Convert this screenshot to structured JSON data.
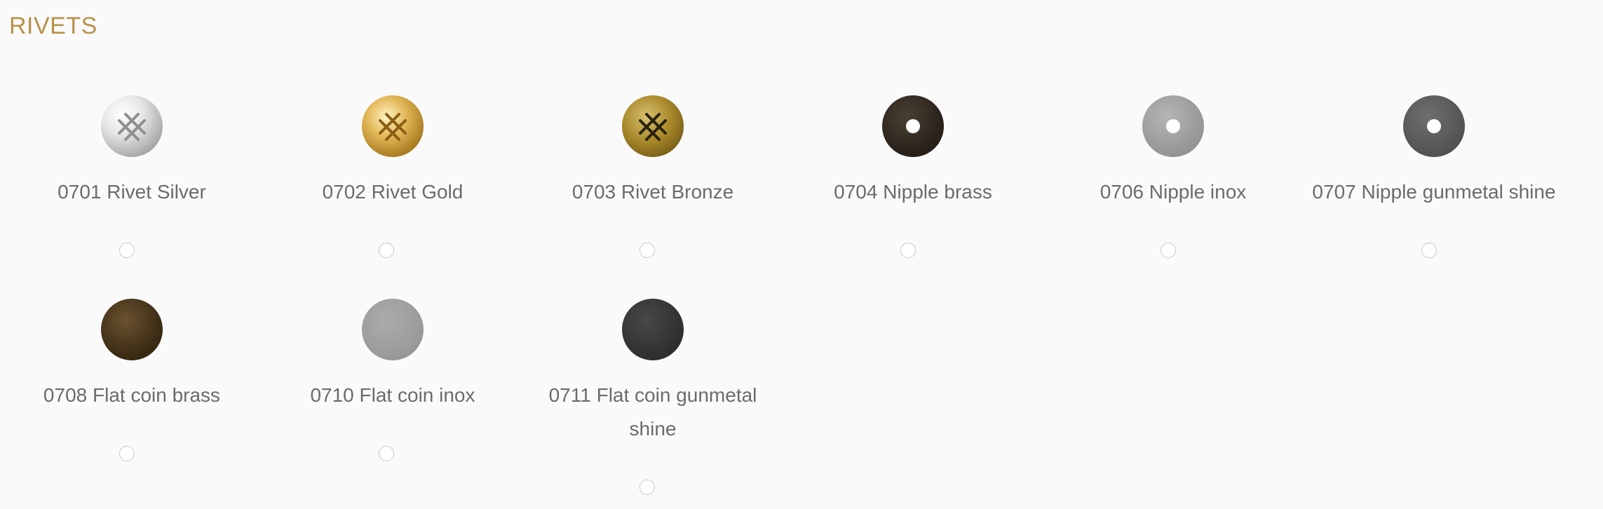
{
  "section": {
    "title": "RIVETS"
  },
  "products": [
    {
      "label": "0701 Rivet Silver",
      "icon": "rivet-silver-icon",
      "finish": "silver",
      "has_hole": false,
      "emboss": true,
      "emboss_color": "#8f8f8f",
      "selected": false
    },
    {
      "label": "0702 Rivet Gold",
      "icon": "rivet-gold-icon",
      "finish": "gold",
      "has_hole": false,
      "emboss": true,
      "emboss_color": "#8a5e14",
      "selected": false
    },
    {
      "label": "0703 Rivet Bronze",
      "icon": "rivet-bronze-icon",
      "finish": "bronze",
      "has_hole": false,
      "emboss": true,
      "emboss_color": "#2a2208",
      "selected": false
    },
    {
      "label": "0704 Nipple brass",
      "icon": "nipple-brass-icon",
      "finish": "dark-brass",
      "has_hole": true,
      "emboss": false,
      "selected": false
    },
    {
      "label": "0706 Nipple inox",
      "icon": "nipple-inox-icon",
      "finish": "inox",
      "has_hole": true,
      "emboss": false,
      "selected": false
    },
    {
      "label": "0707 Nipple gunmetal shine",
      "icon": "nipple-gunmetal-icon",
      "finish": "gunmetal",
      "has_hole": true,
      "emboss": false,
      "selected": false
    },
    {
      "label": "0708 Flat coin brass",
      "icon": "flat-coin-brass-icon",
      "finish": "dark-brass",
      "has_hole": false,
      "emboss": false,
      "selected": false
    },
    {
      "label": "0710 Flat coin inox",
      "icon": "flat-coin-inox-icon",
      "finish": "inox",
      "has_hole": false,
      "emboss": false,
      "selected": false
    },
    {
      "label": "0711 Flat coin gunmetal shine",
      "icon": "flat-coin-gunmetal-icon",
      "finish": "gunmetal",
      "has_hole": false,
      "emboss": false,
      "selected": false
    }
  ],
  "colors": {
    "title": "#b8924a",
    "label": "#6b6b6b",
    "background": "#fafafa",
    "radio_border": "#c8c8c8"
  }
}
